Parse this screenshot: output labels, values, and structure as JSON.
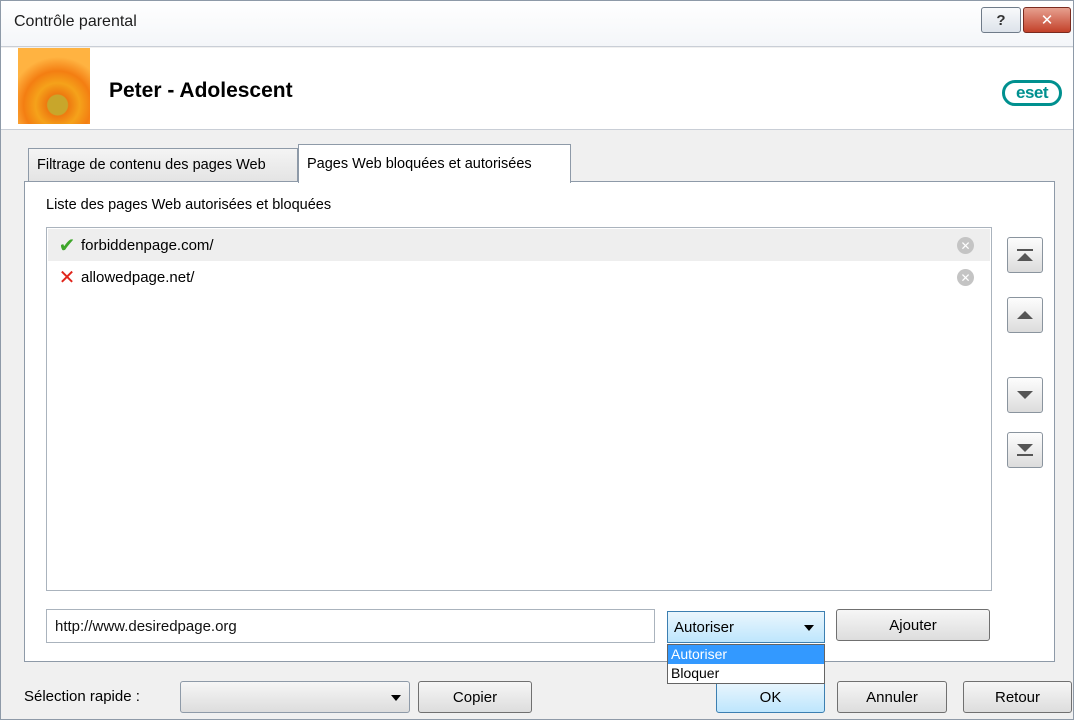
{
  "window": {
    "title": "Contrôle parental",
    "help_label": "?",
    "close_label": "✕"
  },
  "header": {
    "profile_name": "Peter - Adolescent",
    "logo_text": "eset"
  },
  "tabs": [
    {
      "label": "Filtrage de contenu des pages Web",
      "active": false
    },
    {
      "label": "Pages Web bloquées et autorisées",
      "active": true
    }
  ],
  "list": {
    "caption": "Liste des pages Web autorisées et bloquées",
    "items": [
      {
        "mark": "✔",
        "mark_color": "#3ea62a",
        "url": "forbiddenpage.com/",
        "status": "allowed"
      },
      {
        "mark": "✕",
        "mark_color": "#e0251b",
        "url": "allowedpage.net/",
        "status": "blocked"
      }
    ]
  },
  "side_buttons": [
    "move-top-icon",
    "move-up-icon",
    "move-down-icon",
    "move-bottom-icon"
  ],
  "input": {
    "url_value": "http://www.desiredpage.org",
    "action_selected": "Autoriser",
    "action_options": [
      "Autoriser",
      "Bloquer"
    ],
    "add_label": "Ajouter"
  },
  "footer": {
    "quick_label": "Sélection rapide :",
    "quick_value": "",
    "copy_label": "Copier",
    "ok_label": "OK",
    "cancel_label": "Annuler",
    "back_label": "Retour"
  },
  "colors": {
    "accent": "#3c7fb1",
    "eset": "#00908f",
    "allowed": "#3ea62a",
    "blocked": "#e0251b"
  }
}
